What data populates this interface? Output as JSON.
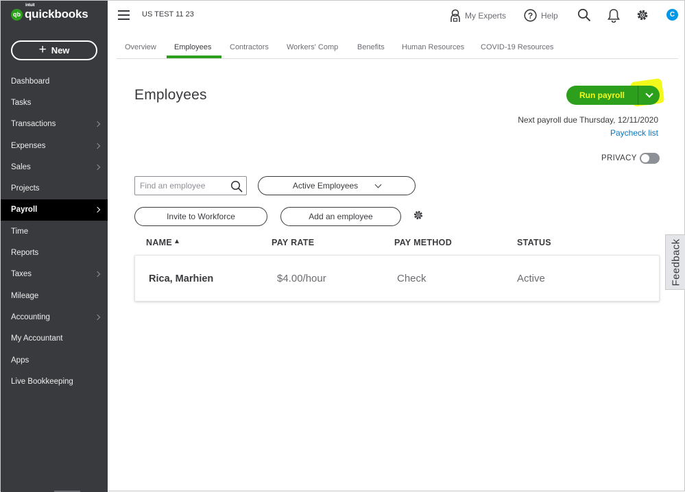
{
  "brand": {
    "logo_badge": "qb",
    "intuit": "intuit",
    "name": "quickbooks",
    "accent": "#2ca01c"
  },
  "sidebar": {
    "new_label": "New",
    "items": [
      {
        "label": "Dashboard",
        "chevron": false
      },
      {
        "label": "Tasks",
        "chevron": false
      },
      {
        "label": "Transactions",
        "chevron": true
      },
      {
        "label": "Expenses",
        "chevron": true
      },
      {
        "label": "Sales",
        "chevron": true
      },
      {
        "label": "Projects",
        "chevron": false
      },
      {
        "label": "Payroll",
        "chevron": true,
        "active": true
      },
      {
        "label": "Time",
        "chevron": false
      },
      {
        "label": "Reports",
        "chevron": false
      },
      {
        "label": "Taxes",
        "chevron": true
      },
      {
        "label": "Mileage",
        "chevron": false
      },
      {
        "label": "Accounting",
        "chevron": true
      },
      {
        "label": "My Accountant",
        "chevron": false
      },
      {
        "label": "Apps",
        "chevron": false
      },
      {
        "label": "Live Bookkeeping",
        "chevron": false
      }
    ]
  },
  "header": {
    "company": "US TEST 11 23",
    "my_experts": "My Experts",
    "help": "Help",
    "avatar_initial": "C"
  },
  "tabs": [
    {
      "label": "Overview"
    },
    {
      "label": "Employees",
      "active": true
    },
    {
      "label": "Contractors"
    },
    {
      "label": "Workers' Comp"
    },
    {
      "label": "Benefits"
    },
    {
      "label": "Human Resources"
    },
    {
      "label": "COVID-19 Resources"
    }
  ],
  "main": {
    "title": "Employees",
    "run_payroll": "Run payroll",
    "next_payroll": "Next payroll due Thursday, 12/11/2020",
    "paycheck_list": "Paycheck list",
    "privacy": "PRIVACY",
    "privacy_on": false,
    "search_placeholder": "Find an employee",
    "filter_value": "Active Employees",
    "invite_label": "Invite to Workforce",
    "add_label": "Add an employee"
  },
  "table": {
    "columns": [
      "NAME",
      "PAY RATE",
      "PAY METHOD",
      "STATUS"
    ],
    "sort_column": "NAME",
    "rows": [
      {
        "name": "Rica, Marhien",
        "pay_rate": "$4.00/hour",
        "pay_method": "Check",
        "status": "Active"
      }
    ]
  },
  "feedback_label": "Feedback",
  "icons": [
    "menu-icon",
    "person-lock-icon",
    "help-icon",
    "search-icon",
    "bell-icon",
    "gear-icon",
    "chevron-down-icon",
    "sort-arrow-icon"
  ]
}
